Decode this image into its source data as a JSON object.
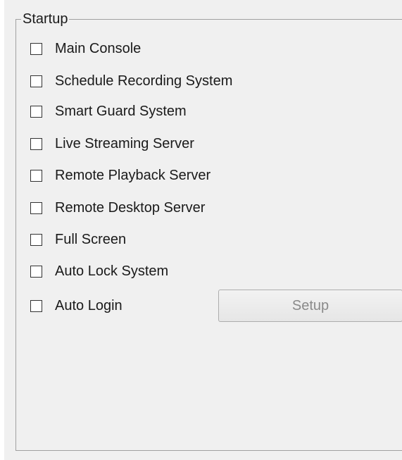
{
  "startup": {
    "title": "Startup",
    "options": [
      {
        "label": "Main Console",
        "checked": false
      },
      {
        "label": "Schedule Recording System",
        "checked": false
      },
      {
        "label": "Smart Guard System",
        "checked": false
      },
      {
        "label": "Live Streaming Server",
        "checked": false
      },
      {
        "label": "Remote Playback Server",
        "checked": false
      },
      {
        "label": "Remote Desktop Server",
        "checked": false
      },
      {
        "label": "Full Screen",
        "checked": false
      },
      {
        "label": "Auto Lock System",
        "checked": false
      },
      {
        "label": "Auto Login",
        "checked": false
      }
    ],
    "setup_label": "Setup"
  }
}
